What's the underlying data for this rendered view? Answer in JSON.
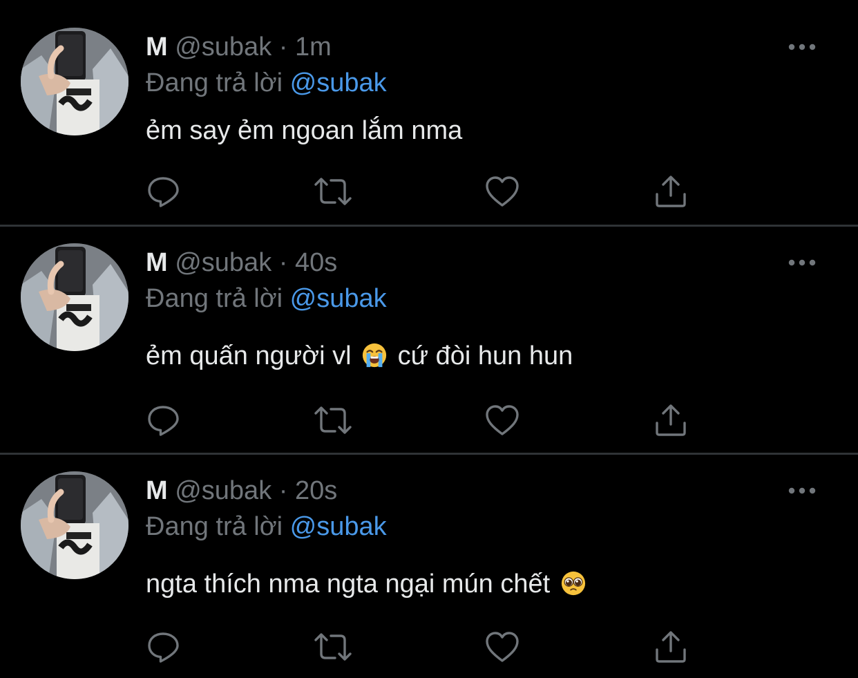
{
  "tweets": [
    {
      "name": "M",
      "handle": "@subak",
      "separator": "·",
      "time": "1m",
      "reply_prefix": "Đang trả lời",
      "reply_to": "@subak",
      "text_before": "ẻm say ẻm ngoan lắm nma",
      "text_after": ""
    },
    {
      "name": "M",
      "handle": "@subak",
      "separator": "·",
      "time": "40s",
      "reply_prefix": "Đang trả lời",
      "reply_to": "@subak",
      "text_before": "ẻm quấn người vl",
      "emoji": "loudly-crying-face",
      "text_after": "cứ đòi hun hun"
    },
    {
      "name": "M",
      "handle": "@subak",
      "separator": "·",
      "time": "20s",
      "reply_prefix": "Đang trả lời",
      "reply_to": "@subak",
      "text_before": "ngta thích nma ngta ngại mún chết",
      "emoji": "pleading-face",
      "text_after": ""
    }
  ],
  "icons": {
    "reply": "reply-icon",
    "retweet": "retweet-icon",
    "like": "heart-icon",
    "share": "share-icon",
    "more": "more-icon"
  },
  "colors": {
    "background": "#000000",
    "text": "#e7e9ea",
    "secondary": "#71767b",
    "mention": "#4a99e9",
    "divider": "#2f3336"
  }
}
